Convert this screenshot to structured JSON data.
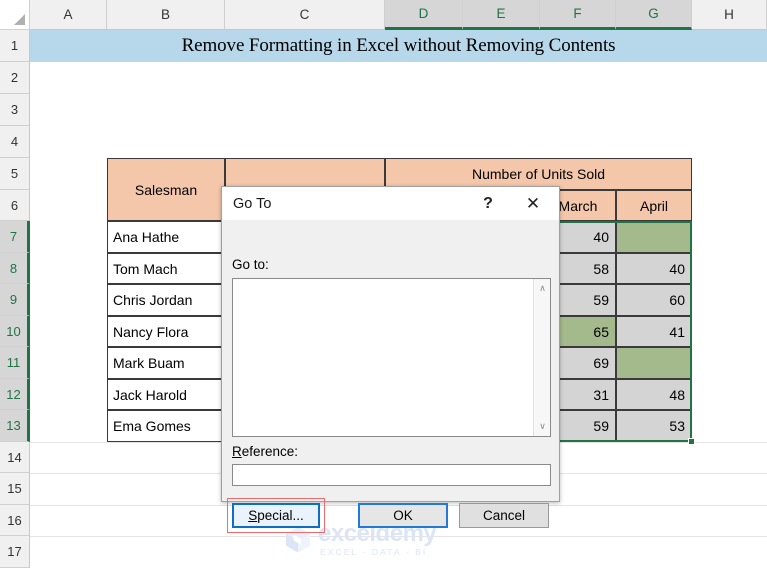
{
  "sheet": {
    "title_banner": "Remove Formatting in Excel without Removing Contents",
    "column_headers": [
      "A",
      "B",
      "C",
      "D",
      "E",
      "F",
      "G",
      "H"
    ],
    "selected_columns": [
      "D",
      "E",
      "F",
      "G"
    ],
    "row_headers": [
      "1",
      "2",
      "3",
      "4",
      "5",
      "6",
      "7",
      "8",
      "9",
      "10",
      "11",
      "12",
      "13",
      "14",
      "15",
      "16",
      "17"
    ],
    "selected_rows": [
      "7",
      "8",
      "9",
      "10",
      "11",
      "12",
      "13"
    ],
    "corner_icon": "select-all-triangle-icon",
    "colors": {
      "banner_fill": "#b7d7ea",
      "table_header_fill": "#f4c7aa",
      "number_cell_fill": "#d4d4d4",
      "highlight_green": "#a4ba8d",
      "selection_border": "#217346",
      "header_selected_fill": "#d6d6d6"
    }
  },
  "table": {
    "merged_header": "Number of Units Sold",
    "col_headers": [
      "Salesman",
      "",
      "",
      "",
      "March",
      "April"
    ],
    "salesman_header": "Salesman",
    "month_march": "March",
    "month_april": "April",
    "rows": [
      {
        "salesman": "Ana Hathe",
        "march": "40",
        "april": "",
        "march_green": false,
        "april_green": true
      },
      {
        "salesman": "Tom Mach",
        "march": "58",
        "april": "40",
        "march_green": false,
        "april_green": false
      },
      {
        "salesman": "Chris Jordan",
        "march": "59",
        "april": "60",
        "march_green": false,
        "april_green": false
      },
      {
        "salesman": "Nancy Flora",
        "march": "65",
        "april": "41",
        "march_green": true,
        "april_green": false
      },
      {
        "salesman": "Mark Buam",
        "march": "69",
        "april": "",
        "march_green": false,
        "april_green": true
      },
      {
        "salesman": "Jack Harold",
        "march": "31",
        "april": "48",
        "march_green": false,
        "april_green": false
      },
      {
        "salesman": "Ema Gomes",
        "march": "59",
        "april": "53",
        "march_green": false,
        "april_green": false
      }
    ]
  },
  "dialog": {
    "title": "Go To",
    "help_glyph": "?",
    "close_glyph": "✕",
    "goto_label": "Go to:",
    "goto_list_value": "",
    "reference_label_underlined": "R",
    "reference_label_rest": "eference:",
    "reference_value": "",
    "reference_placeholder": "",
    "buttons": {
      "special_underlined": "S",
      "special_rest": "pecial...",
      "ok": "OK",
      "cancel": "Cancel"
    },
    "scroll_up_glyph": "∧",
    "scroll_down_glyph": "∨",
    "highlight_color": "#ef6b6b"
  },
  "watermark": {
    "brand": "exceldemy",
    "tagline": "EXCEL · DATA · BI",
    "color": "#dce5f5"
  }
}
